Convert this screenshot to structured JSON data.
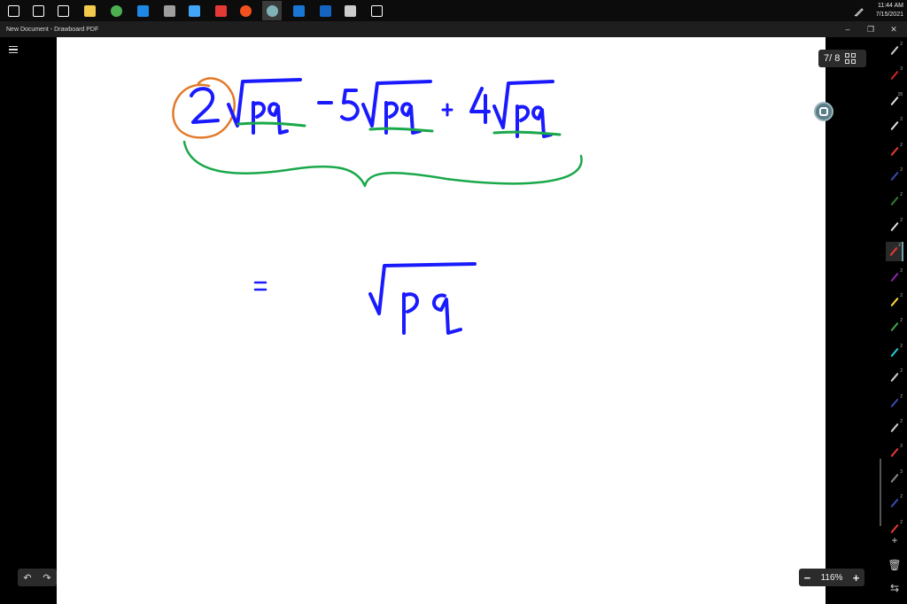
{
  "taskbar": {
    "icons": [
      {
        "name": "windows-start-icon",
        "color": "#ffffff"
      },
      {
        "name": "search-icon",
        "color": "#ffffff"
      },
      {
        "name": "task-view-icon",
        "color": "#ffffff"
      },
      {
        "name": "file-explorer-icon",
        "color": "#f2c94c"
      },
      {
        "name": "chrome-icon",
        "color": "#4caf50"
      },
      {
        "name": "outlook-icon",
        "color": "#1e88e5"
      },
      {
        "name": "app-window-icon",
        "color": "#9e9e9e"
      },
      {
        "name": "remote-desktop-icon",
        "color": "#42a5f5"
      },
      {
        "name": "acrobat-icon",
        "color": "#e53935"
      },
      {
        "name": "ubuntu-icon",
        "color": "#f4511e"
      },
      {
        "name": "drawboard-icon",
        "color": "#7fb3b8"
      },
      {
        "name": "blue-app-icon",
        "color": "#1976d2"
      },
      {
        "name": "mail-icon",
        "color": "#1565c0"
      },
      {
        "name": "paint-icon",
        "color": "#cccccc"
      },
      {
        "name": "settings-gear-icon",
        "color": "#ffffff"
      }
    ],
    "active_index": 10,
    "clock_time": "11:44 AM",
    "clock_date": "7/15/2021"
  },
  "window": {
    "title": "New Document - Drawboard PDF",
    "minimize": "–",
    "maximize": "❐",
    "close": "✕"
  },
  "page_indicator": {
    "text": "7/ 8"
  },
  "zoom": {
    "minus": "−",
    "level": "116%",
    "plus": "+"
  },
  "history": {
    "undo": "↶",
    "redo": "↷"
  },
  "tools": {
    "pens": [
      {
        "color": "#c8c8c8",
        "num": "2"
      },
      {
        "color": "#cc2222",
        "num": "3"
      },
      {
        "color": "#dddddd",
        "num": "28"
      },
      {
        "color": "#dddddd",
        "num": "2"
      },
      {
        "color": "#e53935",
        "num": "2"
      },
      {
        "color": "#3949ab",
        "num": "2"
      },
      {
        "color": "#2e7d32",
        "num": "2"
      },
      {
        "color": "#e0e0e0",
        "num": "2"
      },
      {
        "color": "#e53935",
        "num": "2"
      },
      {
        "color": "#8e24aa",
        "num": "2"
      },
      {
        "color": "#fdd835",
        "num": "2"
      },
      {
        "color": "#43a047",
        "num": "2"
      },
      {
        "color": "#26c6da",
        "num": "2"
      },
      {
        "color": "#cfcfcf",
        "num": "2"
      },
      {
        "color": "#3949ab",
        "num": "2"
      },
      {
        "color": "#cfcfcf",
        "num": "2"
      },
      {
        "color": "#e53935",
        "num": "2"
      },
      {
        "color": "#888888",
        "num": "3"
      },
      {
        "color": "#3949ab",
        "num": "2"
      },
      {
        "color": "#e53935",
        "num": "2"
      }
    ],
    "selected_index": 8,
    "add": "+",
    "delete": "🗑",
    "swap": "⇆"
  },
  "ink": {
    "blue": "#1a1aff",
    "green": "#1aa84a",
    "orange": "#e27a2b"
  }
}
